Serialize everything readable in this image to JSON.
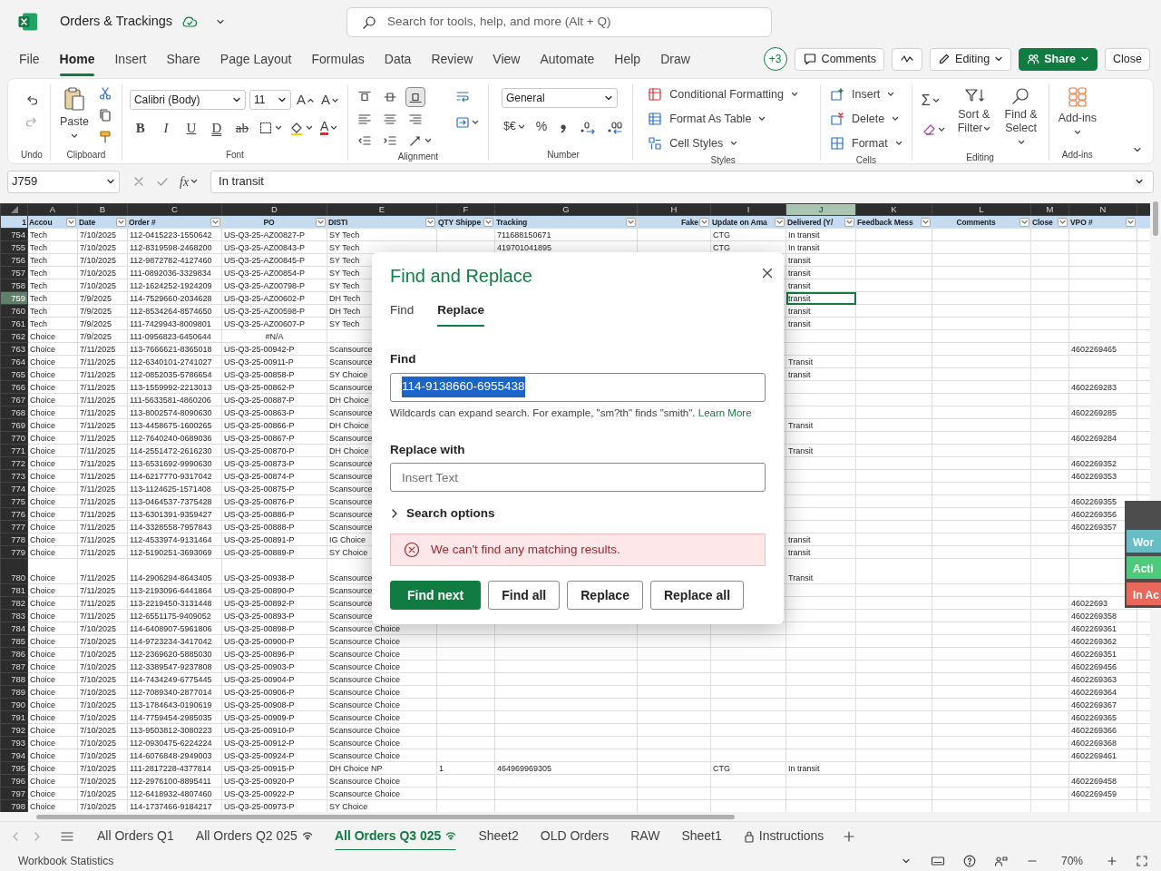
{
  "app": {
    "title": "Orders & Trackings",
    "search_placeholder": "Search for tools, help, and more (Alt + Q)"
  },
  "menu_tabs": [
    {
      "label": "File",
      "selected": false
    },
    {
      "label": "Home",
      "selected": true
    },
    {
      "label": "Insert",
      "selected": false
    },
    {
      "label": "Share",
      "selected": false
    },
    {
      "label": "Page Layout",
      "selected": false
    },
    {
      "label": "Formulas",
      "selected": false
    },
    {
      "label": "Data",
      "selected": false
    },
    {
      "label": "Review",
      "selected": false
    },
    {
      "label": "View",
      "selected": false
    },
    {
      "label": "Automate",
      "selected": false
    },
    {
      "label": "Help",
      "selected": false
    },
    {
      "label": "Draw",
      "selected": false
    }
  ],
  "header_actions": {
    "collaborators": "+3",
    "comments": "Comments",
    "editing": "Editing",
    "share": "Share",
    "close": "Close"
  },
  "ribbon": {
    "undo": {
      "label": "Undo"
    },
    "clipboard": {
      "paste": "Paste",
      "label": "Clipboard"
    },
    "font": {
      "family": "Calibri (Body)",
      "size": "11",
      "size_letters": [
        "A",
        "A"
      ],
      "styles": [
        "B",
        "I",
        "U",
        "D",
        "ab"
      ],
      "color_letter": "A",
      "label": "Font"
    },
    "alignment": {
      "label": "Alignment"
    },
    "number": {
      "format": "General",
      "currency": "$€",
      "percent": "%",
      "label": "Number"
    },
    "styles": {
      "items": [
        "Conditional Formatting",
        "Format As Table",
        "Cell Styles"
      ],
      "label": "Styles"
    },
    "cells": {
      "items": [
        "Insert",
        "Delete",
        "Format"
      ],
      "label": "Cells"
    },
    "editing": {
      "sigma": "Σ",
      "items": [
        "Sort & Filter",
        "Find & Select"
      ],
      "label": "Editing"
    },
    "addins": {
      "button": "Add-ins",
      "label": "Add-ins"
    }
  },
  "formula_bar": {
    "name_box": "J759",
    "fx": "fx",
    "value": "In transit"
  },
  "sheet": {
    "columns": [
      {
        "letter": "A",
        "header": "Accou",
        "selected": false
      },
      {
        "letter": "B",
        "header": "Date",
        "selected": false
      },
      {
        "letter": "C",
        "header": "Order #",
        "selected": false
      },
      {
        "letter": "D",
        "header": "PO",
        "selected": false
      },
      {
        "letter": "E",
        "header": "DISTI",
        "selected": false
      },
      {
        "letter": "F",
        "header": "QTY Shippe",
        "selected": false
      },
      {
        "letter": "G",
        "header": "Tracking",
        "selected": false
      },
      {
        "letter": "H",
        "header": "Fake",
        "selected": false
      },
      {
        "letter": "I",
        "header": "Update on Ama",
        "selected": false
      },
      {
        "letter": "J",
        "header": "Delivered (Y/",
        "selected": true
      },
      {
        "letter": "K",
        "header": "Feedback Mess",
        "selected": false
      },
      {
        "letter": "L",
        "header": "Comments",
        "selected": false
      },
      {
        "letter": "M",
        "header": "Close",
        "selected": false
      },
      {
        "letter": "N",
        "header": "VPO #",
        "selected": false
      }
    ],
    "header_row": "1",
    "rows": [
      {
        "num": "754",
        "selected": false,
        "a": "Tech",
        "b": "7/10/2025",
        "c": "112-0415223-1550642",
        "d": "US-Q3-25-AZ00827-P",
        "e": "SY Tech",
        "g": "711688150671",
        "i": "CTG",
        "j": "In transit"
      },
      {
        "num": "755",
        "selected": false,
        "a": "Tech",
        "b": "7/10/2025",
        "c": "112-8319598-2468200",
        "d": "US-Q3-25-AZ00843-P",
        "e": "SY Tech",
        "g": "419701041895",
        "i": "CTG",
        "j": "In transit"
      },
      {
        "num": "756",
        "selected": false,
        "a": "Tech",
        "b": "7/10/2025",
        "c": "112-9872782-4127460",
        "d": "US-Q3-25-AZ00845-P",
        "e": "SY Tech",
        "j": "transit"
      },
      {
        "num": "757",
        "selected": false,
        "a": "Tech",
        "b": "7/10/2025",
        "c": "111-0892036-3329834",
        "d": "US-Q3-25-AZ00854-P",
        "e": "SY Tech",
        "j": "transit"
      },
      {
        "num": "758",
        "selected": false,
        "a": "Tech",
        "b": "7/10/2025",
        "c": "112-1624252-1924209",
        "d": "US-Q3-25-AZ00798-P",
        "e": "SY Tech",
        "j": "transit"
      },
      {
        "num": "759",
        "selected": true,
        "a": "Tech",
        "b": "7/9/2025",
        "c": "114-7529660-2034628",
        "d": "US-Q3-25-AZ00602-P",
        "e": "DH Tech",
        "j": "transit"
      },
      {
        "num": "760",
        "selected": false,
        "a": "Tech",
        "b": "7/9/2025",
        "c": "112-8534264-8574650",
        "d": "US-Q3-25-AZ00598-P",
        "e": "DH Tech",
        "j": "transit"
      },
      {
        "num": "761",
        "selected": false,
        "a": "Tech",
        "b": "7/9/2025",
        "c": "111-7429943-8009801",
        "d": "US-Q3-25-AZ00607-P",
        "e": "SY Tech",
        "j": "transit"
      },
      {
        "num": "762",
        "selected": false,
        "a": "Choice",
        "b": "7/9/2025",
        "c": "111-0956823-6450644",
        "d": "#N/A"
      },
      {
        "num": "763",
        "selected": false,
        "a": "Choice",
        "b": "7/11/2025",
        "c": "113-7666621-8365018",
        "d": "US-Q3-25-00942-P",
        "e": "Scansource",
        "n": "4602269465"
      },
      {
        "num": "764",
        "selected": false,
        "a": "Choice",
        "b": "7/11/2025",
        "c": "112-6340101-2741027",
        "d": "US-Q3-25-00911-P",
        "e": "Scansource",
        "j": "Transit"
      },
      {
        "num": "765",
        "selected": false,
        "a": "Choice",
        "b": "7/11/2025",
        "c": "112-0852035-5786654",
        "d": "US-Q3-25-00858-P",
        "e": "SY Choice",
        "j": "transit"
      },
      {
        "num": "766",
        "selected": false,
        "a": "Choice",
        "b": "7/11/2025",
        "c": "113-1559992-2213013",
        "d": "US-Q3-25-00862-P",
        "e": "Scansource",
        "n": "4602269283"
      },
      {
        "num": "767",
        "selected": false,
        "a": "Choice",
        "b": "7/11/2025",
        "c": "111-5633581-4860206",
        "d": "US-Q3-25-00887-P",
        "e": "DH Choice"
      },
      {
        "num": "768",
        "selected": false,
        "a": "Choice",
        "b": "7/11/2025",
        "c": "113-8002574-8090630",
        "d": "US-Q3-25-00863-P",
        "e": "Scansource",
        "n": "4602269285"
      },
      {
        "num": "769",
        "selected": false,
        "a": "Choice",
        "b": "7/11/2025",
        "c": "113-4458675-1600265",
        "d": "US-Q3-25-00866-P",
        "e": "DH Choice",
        "j": "Transit"
      },
      {
        "num": "770",
        "selected": false,
        "a": "Choice",
        "b": "7/11/2025",
        "c": "112-7640240-0689036",
        "d": "US-Q3-25-00867-P",
        "e": "Scansource",
        "n": "4602269284"
      },
      {
        "num": "771",
        "selected": false,
        "a": "Choice",
        "b": "7/11/2025",
        "c": "114-2551472-2616230",
        "d": "US-Q3-25-00870-P",
        "e": "DH Choice",
        "j": "Transit"
      },
      {
        "num": "772",
        "selected": false,
        "a": "Choice",
        "b": "7/11/2025",
        "c": "113-6531692-9990630",
        "d": "US-Q3-25-00873-P",
        "e": "Scansource",
        "n": "4602269352"
      },
      {
        "num": "773",
        "selected": false,
        "a": "Choice",
        "b": "7/11/2025",
        "c": "114-6217770-9317042",
        "d": "US-Q3-25-00874-P",
        "e": "Scansource",
        "n": "4602269353"
      },
      {
        "num": "774",
        "selected": false,
        "a": "Choice",
        "b": "7/11/2025",
        "c": "113-1124625-1571408",
        "d": "US-Q3-25-00875-P",
        "e": "Scansource"
      },
      {
        "num": "775",
        "selected": false,
        "a": "Choice",
        "b": "7/11/2025",
        "c": "113-0464537-7375428",
        "d": "US-Q3-25-00876-P",
        "e": "Scansource",
        "n": "4602269355"
      },
      {
        "num": "776",
        "selected": false,
        "a": "Choice",
        "b": "7/11/2025",
        "c": "113-6301391-9359427",
        "d": "US-Q3-25-00886-P",
        "e": "Scansource",
        "n": "4602269356"
      },
      {
        "num": "777",
        "selected": false,
        "a": "Choice",
        "b": "7/11/2025",
        "c": "114-3328558-7957843",
        "d": "US-Q3-25-00888-P",
        "e": "Scansource",
        "n": "4602269357"
      },
      {
        "num": "778",
        "selected": false,
        "a": "Choice",
        "b": "7/11/2025",
        "c": "112-4533974-9131464",
        "d": "US-Q3-25-00891-P",
        "e": "IG Choice",
        "j": "transit"
      },
      {
        "num": "779",
        "selected": false,
        "a": "Choice",
        "b": "7/11/2025",
        "c": "112-5190251-3693069",
        "d": "US-Q3-25-00889-P",
        "e": "SY Choice",
        "j": "transit"
      },
      {
        "num": "780",
        "selected": false,
        "tall": true,
        "a": "Choice",
        "b": "7/11/2025",
        "c": "114-2906294-8643405",
        "d": "US-Q3-25-00938-P",
        "e": "Scansource",
        "j": "Transit"
      },
      {
        "num": "781",
        "selected": false,
        "a": "Choice",
        "b": "7/11/2025",
        "c": "113-2193096-6441864",
        "d": "US-Q3-25-00890-P",
        "e": "Scansource"
      },
      {
        "num": "782",
        "selected": false,
        "a": "Choice",
        "b": "7/11/2025",
        "c": "113-2219450-3131448",
        "d": "US-Q3-25-00892-P",
        "e": "Scansource",
        "n": "46022693"
      },
      {
        "num": "783",
        "selected": false,
        "a": "Choice",
        "b": "7/11/2025",
        "c": "112-6551175-9409052",
        "d": "US-Q3-25-00893-P",
        "e": "Scansource",
        "n": "4602269358"
      },
      {
        "num": "784",
        "selected": false,
        "a": "Choice",
        "b": "7/10/2025",
        "c": "114-6408907-5961806",
        "d": "US-Q3-25-00898-P",
        "e": "Scansource Choice",
        "n": "4602269361"
      },
      {
        "num": "785",
        "selected": false,
        "a": "Choice",
        "b": "7/10/2025",
        "c": "114-9723234-3417042",
        "d": "US-Q3-25-00900-P",
        "e": "Scansource Choice",
        "n": "4602269362"
      },
      {
        "num": "786",
        "selected": false,
        "a": "Choice",
        "b": "7/10/2025",
        "c": "112-2369620-5885030",
        "d": "US-Q3-25-00896-P",
        "e": "Scansource Choice",
        "n": "4602269351"
      },
      {
        "num": "787",
        "selected": false,
        "a": "Choice",
        "b": "7/10/2025",
        "c": "112-3389547-9237808",
        "d": "US-Q3-25-00903-P",
        "e": "Scansource Choice",
        "n": "4602269456"
      },
      {
        "num": "788",
        "selected": false,
        "a": "Choice",
        "b": "7/10/2025",
        "c": "114-7434249-6775445",
        "d": "US-Q3-25-00904-P",
        "e": "Scansource Choice",
        "n": "4602269363"
      },
      {
        "num": "789",
        "selected": false,
        "a": "Choice",
        "b": "7/10/2025",
        "c": "112-7089340-2877014",
        "d": "US-Q3-25-00906-P",
        "e": "Scansource Choice",
        "n": "4602269364"
      },
      {
        "num": "790",
        "selected": false,
        "a": "Choice",
        "b": "7/10/2025",
        "c": "113-1784643-0190619",
        "d": "US-Q3-25-00908-P",
        "e": "Scansource Choice",
        "n": "4602269367"
      },
      {
        "num": "791",
        "selected": false,
        "a": "Choice",
        "b": "7/10/2025",
        "c": "114-7759454-2985035",
        "d": "US-Q3-25-00909-P",
        "e": "Scansource Choice",
        "n": "4602269365"
      },
      {
        "num": "792",
        "selected": false,
        "a": "Choice",
        "b": "7/10/2025",
        "c": "113-9503812-3080223",
        "d": "US-Q3-25-00910-P",
        "e": "Scansource Choice",
        "n": "4602269366"
      },
      {
        "num": "793",
        "selected": false,
        "a": "Choice",
        "b": "7/10/2025",
        "c": "112-0930475-6224224",
        "d": "US-Q3-25-00912-P",
        "e": "Scansource Choice",
        "n": "4602269368"
      },
      {
        "num": "794",
        "selected": false,
        "a": "Choice",
        "b": "7/10/2025",
        "c": "114-6076848-2949003",
        "d": "US-Q3-25-00924-P",
        "e": "Scansource Choice",
        "n": "4602269461"
      },
      {
        "num": "795",
        "selected": false,
        "a": "Choice",
        "b": "7/10/2025",
        "c": "111-2817228-4377814",
        "d": "US-Q3-25-00915-P",
        "e": "DH Choice NP",
        "f": "1",
        "g": "464969969305",
        "i": "CTG",
        "j": "In transit"
      },
      {
        "num": "796",
        "selected": false,
        "a": "Choice",
        "b": "7/10/2025",
        "c": "112-2976100-8895411",
        "d": "US-Q3-25-00920-P",
        "e": "Scansource Choice",
        "n": "4602269458"
      },
      {
        "num": "797",
        "selected": false,
        "a": "Choice",
        "b": "7/10/2025",
        "c": "112-6418932-4807460",
        "d": "US-Q3-25-00922-P",
        "e": "Scansource Choice",
        "n": "4602269459"
      },
      {
        "num": "798",
        "selected": false,
        "a": "Choice",
        "b": "7/10/2025",
        "c": "114-1737466-9184217",
        "d": "US-Q3-25-00973-P",
        "e": "SY Choice"
      }
    ]
  },
  "dialog": {
    "title": "Find and Replace",
    "tabs": [
      {
        "label": "Find",
        "selected": false
      },
      {
        "label": "Replace",
        "selected": true
      }
    ],
    "find_label": "Find",
    "find_value": "114-9138660-6955438",
    "hint": "Wildcards can expand search. For example, \"sm?th\" finds \"smith\".",
    "hint_link": "Learn More",
    "replace_label": "Replace with",
    "replace_placeholder": "Insert Text",
    "search_options": {
      "label": "Search options",
      "expanded": false
    },
    "error": "We can't find any matching results.",
    "buttons": [
      {
        "label": "Find next",
        "primary": true
      },
      {
        "label": "Find all",
        "primary": false
      },
      {
        "label": "Replace",
        "primary": false
      },
      {
        "label": "Replace all",
        "primary": false
      }
    ]
  },
  "side_panel": {
    "items": [
      {
        "label": "Wor",
        "color": "#67bcc6"
      },
      {
        "label": "Acti",
        "color": "#4ccb7d"
      },
      {
        "label": "In Ac",
        "color": "#e8685b"
      }
    ]
  },
  "sheet_tabs": [
    {
      "label": "All Orders Q1",
      "selected": false,
      "kind": "plain"
    },
    {
      "label": "All Orders Q2 025",
      "selected": false,
      "kind": "shared"
    },
    {
      "label": "All Orders Q3 025",
      "selected": true,
      "kind": "shared"
    },
    {
      "label": "Sheet2",
      "selected": false,
      "kind": "plain"
    },
    {
      "label": "OLD Orders",
      "selected": false,
      "kind": "plain"
    },
    {
      "label": "RAW",
      "selected": false,
      "kind": "plain"
    },
    {
      "label": "Sheet1",
      "selected": false,
      "kind": "plain"
    },
    {
      "label": "Instructions",
      "selected": false,
      "kind": "locked"
    }
  ],
  "status_bar": {
    "left": "Workbook Statistics",
    "zoom": "70%"
  }
}
